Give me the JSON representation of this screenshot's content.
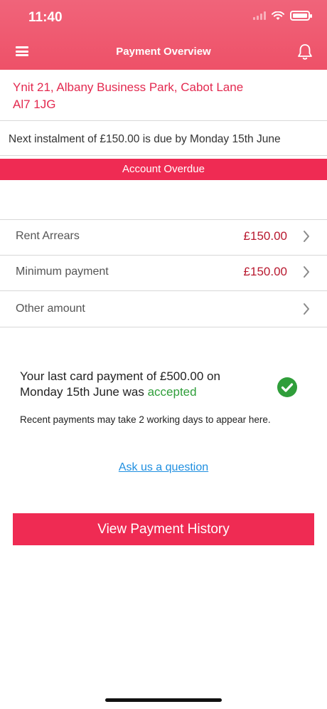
{
  "status_bar": {
    "time": "11:40"
  },
  "header": {
    "title": "Payment Overview"
  },
  "address": {
    "line1": "Ynit 21, Albany Business Park, Cabot Lane",
    "line2": "Al7 1JG"
  },
  "instalment_text": "Next instalment of £150.00 is due by Monday 15th June",
  "overdue_label": "Account Overdue",
  "options": [
    {
      "label": "Rent Arrears",
      "amount": "£150.00"
    },
    {
      "label": "Minimum payment",
      "amount": "£150.00"
    },
    {
      "label": "Other amount",
      "amount": ""
    }
  ],
  "last_payment": {
    "text": "Your last card payment of £500.00 on Monday 15th June was",
    "status": "accepted",
    "note": "Recent payments may take 2 working days to appear here."
  },
  "ask_link": "Ask us a question",
  "history_button": "View Payment History",
  "colors": {
    "header": "#ee5168",
    "accent": "#ef2b53",
    "address": "#e3294f",
    "amount": "#b8192f",
    "success": "#2f9e3a",
    "link": "#1f8fe0"
  }
}
